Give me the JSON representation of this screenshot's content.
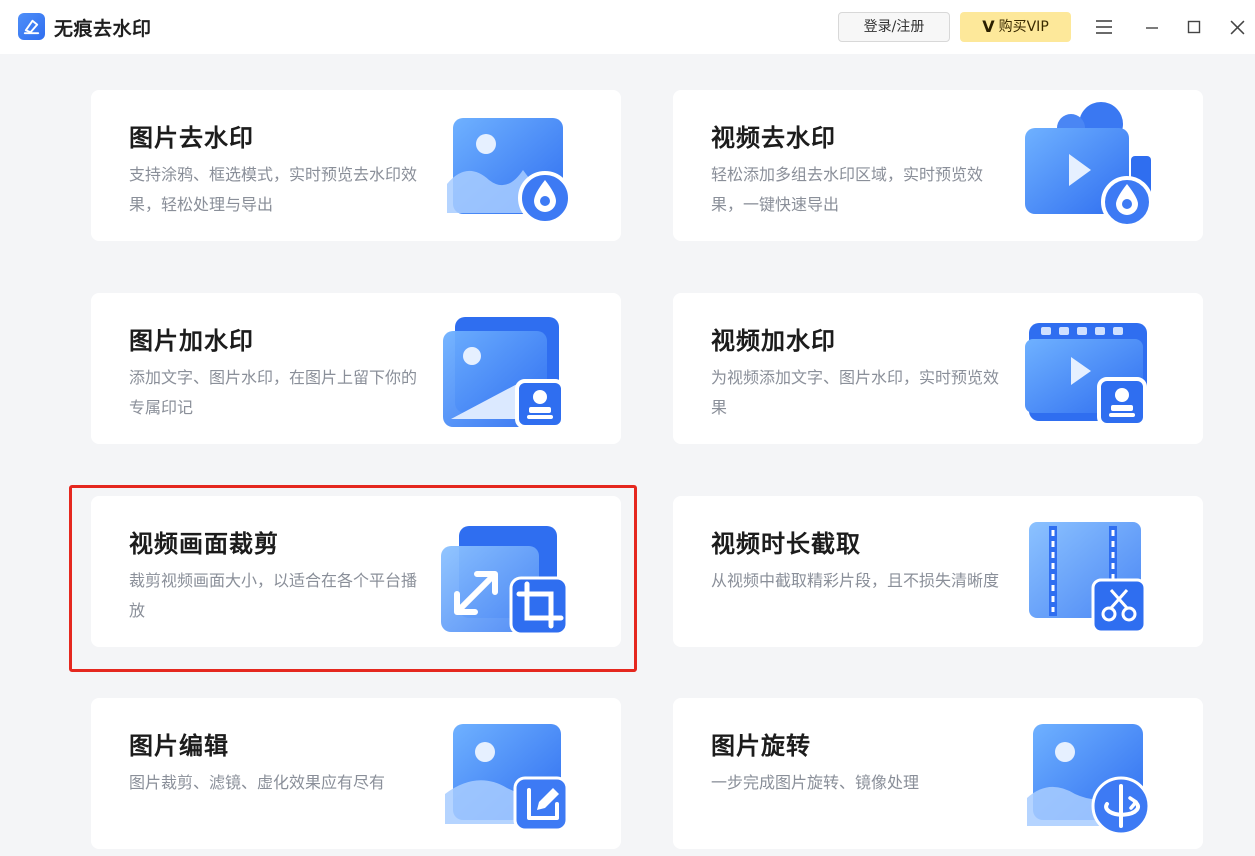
{
  "app": {
    "title": "无痕去水印"
  },
  "header": {
    "login_label": "登录/注册",
    "vip_label": "购买VIP",
    "vip_mark": "V"
  },
  "cards": [
    {
      "title": "图片去水印",
      "desc": "支持涂鸦、框选模式，实时预览去水印效果，轻松处理与导出"
    },
    {
      "title": "视频去水印",
      "desc": "轻松添加多组去水印区域，实时预览效果，一键快速导出"
    },
    {
      "title": "图片加水印",
      "desc": "添加文字、图片水印，在图片上留下你的专属印记"
    },
    {
      "title": "视频加水印",
      "desc": "为视频添加文字、图片水印，实时预览效果"
    },
    {
      "title": "视频画面裁剪",
      "desc": "裁剪视频画面大小，以适合在各个平台播放"
    },
    {
      "title": "视频时长截取",
      "desc": "从视频中截取精彩片段，且不损失清晰度"
    },
    {
      "title": "图片编辑",
      "desc": "图片裁剪、滤镜、虚化效果应有尽有"
    },
    {
      "title": "图片旋转",
      "desc": "一步完成图片旋转、镜像处理"
    }
  ],
  "icons": {
    "card_0": "image-watermark-remove-icon",
    "card_1": "video-watermark-remove-icon",
    "card_2": "image-watermark-add-icon",
    "card_3": "video-watermark-add-icon",
    "card_4": "video-crop-icon",
    "card_5": "video-trim-icon",
    "card_6": "image-edit-icon",
    "card_7": "image-rotate-icon"
  },
  "colors": {
    "accent": "#2f6ef0",
    "vip_bg": "#fde89a",
    "highlight": "#e5281f"
  }
}
